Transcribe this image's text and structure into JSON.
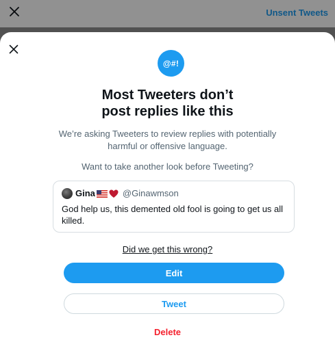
{
  "topbar": {
    "close_icon": "close-icon",
    "unsent_label": "Unsent Tweets"
  },
  "modal": {
    "close_icon": "close-icon",
    "badge_text": "@#!",
    "title_line1": "Most Tweeters don’t",
    "title_line2": "post replies like this",
    "description": "We’re asking Tweeters to review replies with potentially harmful or offensive language.",
    "prompt": "Want to take another look before Tweeting?",
    "tweet": {
      "display_name": "Gina",
      "handle": "@Ginawmson",
      "text": "God help us, this demented old fool is going to get us all killed.",
      "flag_icon": "us-flag-icon",
      "heart_icon": "red-heart-icon"
    },
    "feedback_link": "Did we get this wrong?",
    "edit_label": "Edit",
    "tweet_label": "Tweet",
    "delete_label": "Delete"
  },
  "colors": {
    "accent": "#1d9bf0",
    "danger": "#f4212e",
    "muted_text": "#536471"
  }
}
